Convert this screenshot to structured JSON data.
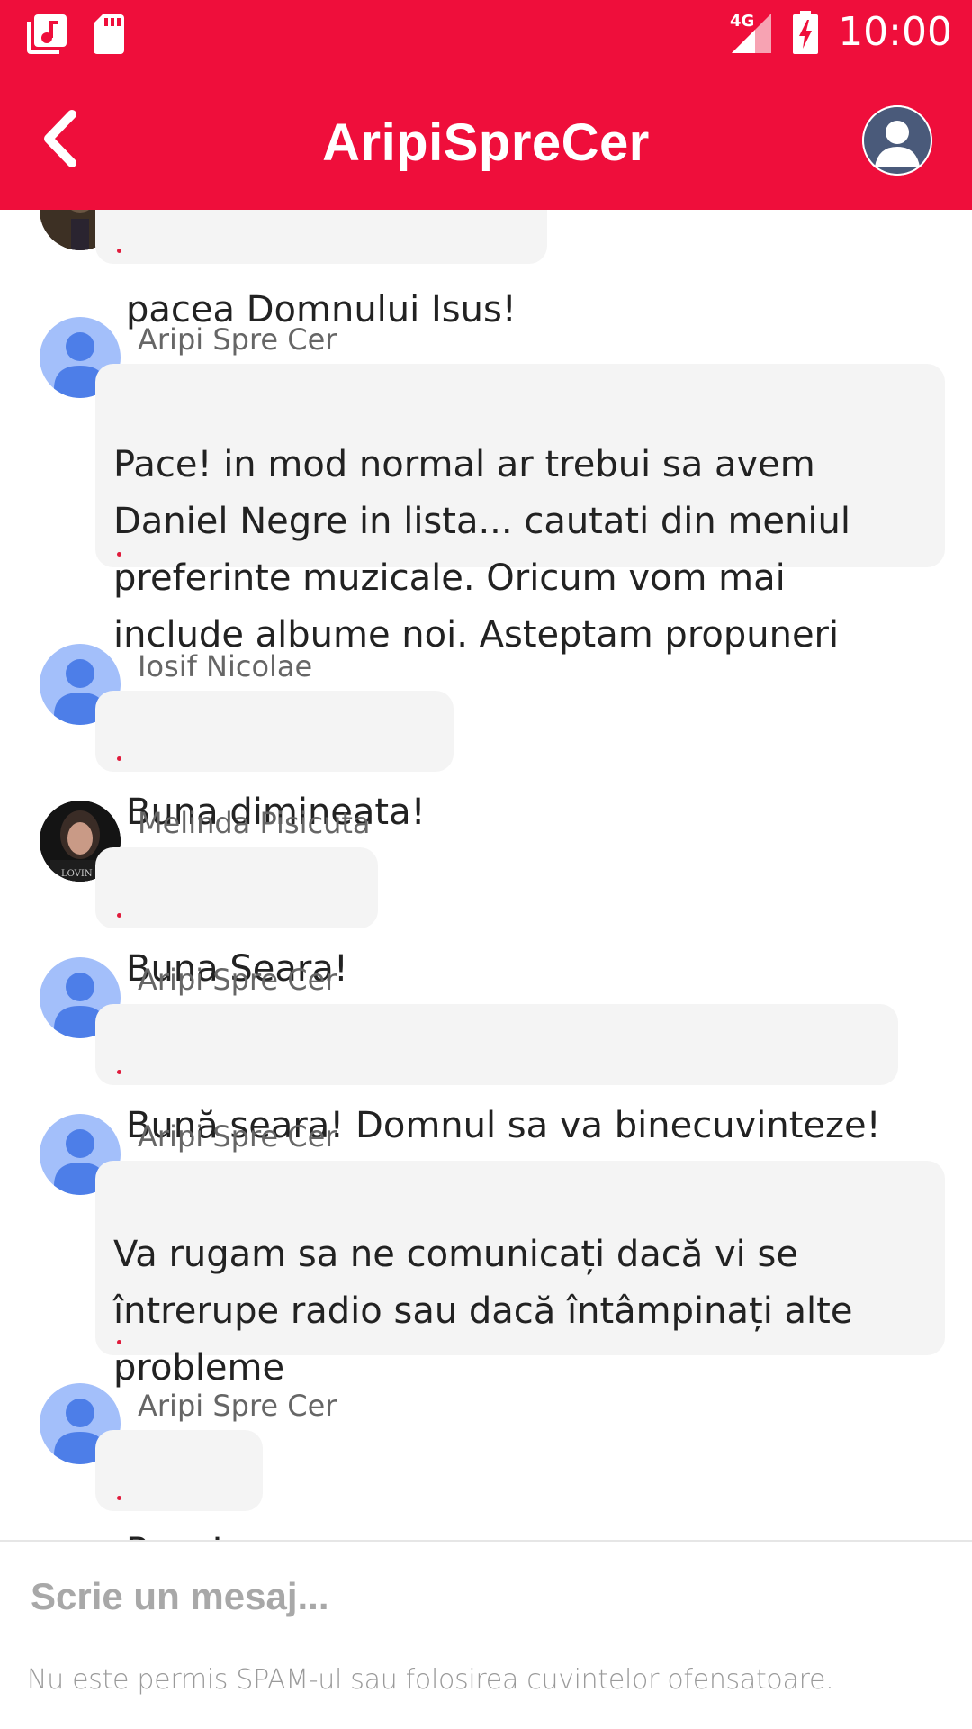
{
  "status_bar": {
    "time": "10:00",
    "network": "4G",
    "icons": [
      "music-library-icon",
      "sd-card-icon",
      "signal-icon",
      "battery-charging-icon"
    ]
  },
  "app_bar": {
    "title": "AripiSpreCer",
    "back_icon": "chevron-left-icon",
    "profile_icon": "user-avatar-icon"
  },
  "messages": [
    {
      "sender": "",
      "text": "pacea Domnului Isus!",
      "avatar": "photo"
    },
    {
      "sender": "Aripi Spre Cer",
      "text": " Pace! in mod normal ar trebui sa avem\nDaniel Negre in lista... cautati din meniul\npreferinte muzicale. Oricum vom mai\ninclude albume noi. Asteptam propuneri",
      "avatar": "generic"
    },
    {
      "sender": "Iosif Nicolae",
      "text": "Buna dimineata!",
      "avatar": "generic"
    },
    {
      "sender": "Melinda Pisicuta",
      "text": "Buna Seara!",
      "avatar": "photo"
    },
    {
      "sender": "Aripi Spre Cer",
      "text": "Bună seara! Domnul sa va binecuvinteze!",
      "avatar": "generic"
    },
    {
      "sender": "Aripi Spre Cer",
      "text": " Va rugam sa ne comunicați dacă vi se\nîntrerupe radio sau dacă întâmpinați alte\nprobleme",
      "avatar": "generic"
    },
    {
      "sender": "Aripi Spre Cer",
      "text": "Pace!",
      "avatar": "generic"
    }
  ],
  "composer": {
    "placeholder": "Scrie un mesaj...",
    "value": "",
    "disclaimer": "Nu este permis SPAM-ul sau folosirea cuvintelor ofensatoare."
  },
  "colors": {
    "primary": "#ef0e3b",
    "bubble": "#f4f4f4",
    "avatar_generic": "#a3bffa",
    "avatar_figure": "#4d7ee8"
  }
}
